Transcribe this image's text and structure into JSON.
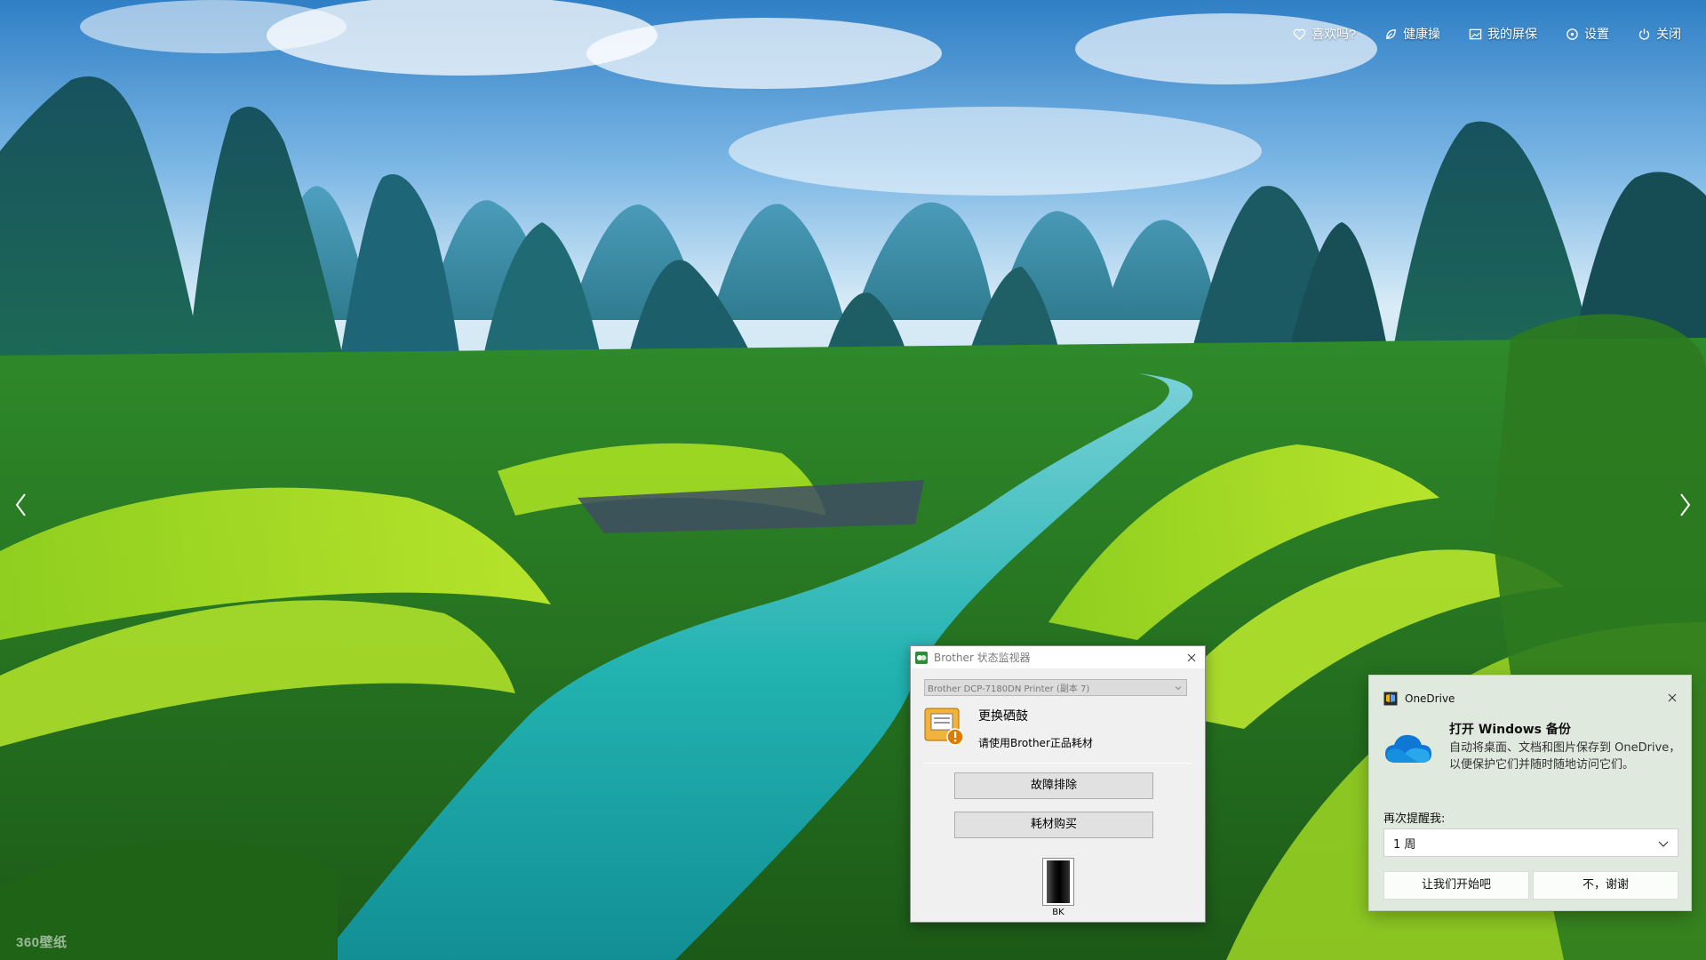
{
  "topbar": {
    "items": [
      {
        "label": "喜欢吗?",
        "icon": "heart-icon"
      },
      {
        "label": "健康操",
        "icon": "leaf-icon"
      },
      {
        "label": "我的屏保",
        "icon": "image-icon"
      },
      {
        "label": "设置",
        "icon": "gear-icon"
      },
      {
        "label": "关闭",
        "icon": "power-icon"
      }
    ]
  },
  "wallpaper": {
    "brand": "360壁纸"
  },
  "brother_monitor": {
    "title": "Brother 状态监视器",
    "printer_select": "Brother DCP-7180DN Printer (副本 7)",
    "status_title": "更换硒鼓",
    "status_subtitle": "请使用Brother正品耗材",
    "troubleshoot_button": "故障排除",
    "supplies_button": "耗材购买",
    "ink_label": "BK",
    "accent_color": "#e07b00"
  },
  "onedrive_toast": {
    "app_name": "OneDrive",
    "title": "打开 Windows 备份",
    "body": "自动将桌面、文档和图片保存到 OneDrive，以便保护它们并随时随地访问它们。",
    "remind_label": "再次提醒我:",
    "remind_value": "1 周",
    "primary_button": "让我们开始吧",
    "secondary_button": "不，谢谢",
    "cloud_color": "#0f78d4"
  }
}
